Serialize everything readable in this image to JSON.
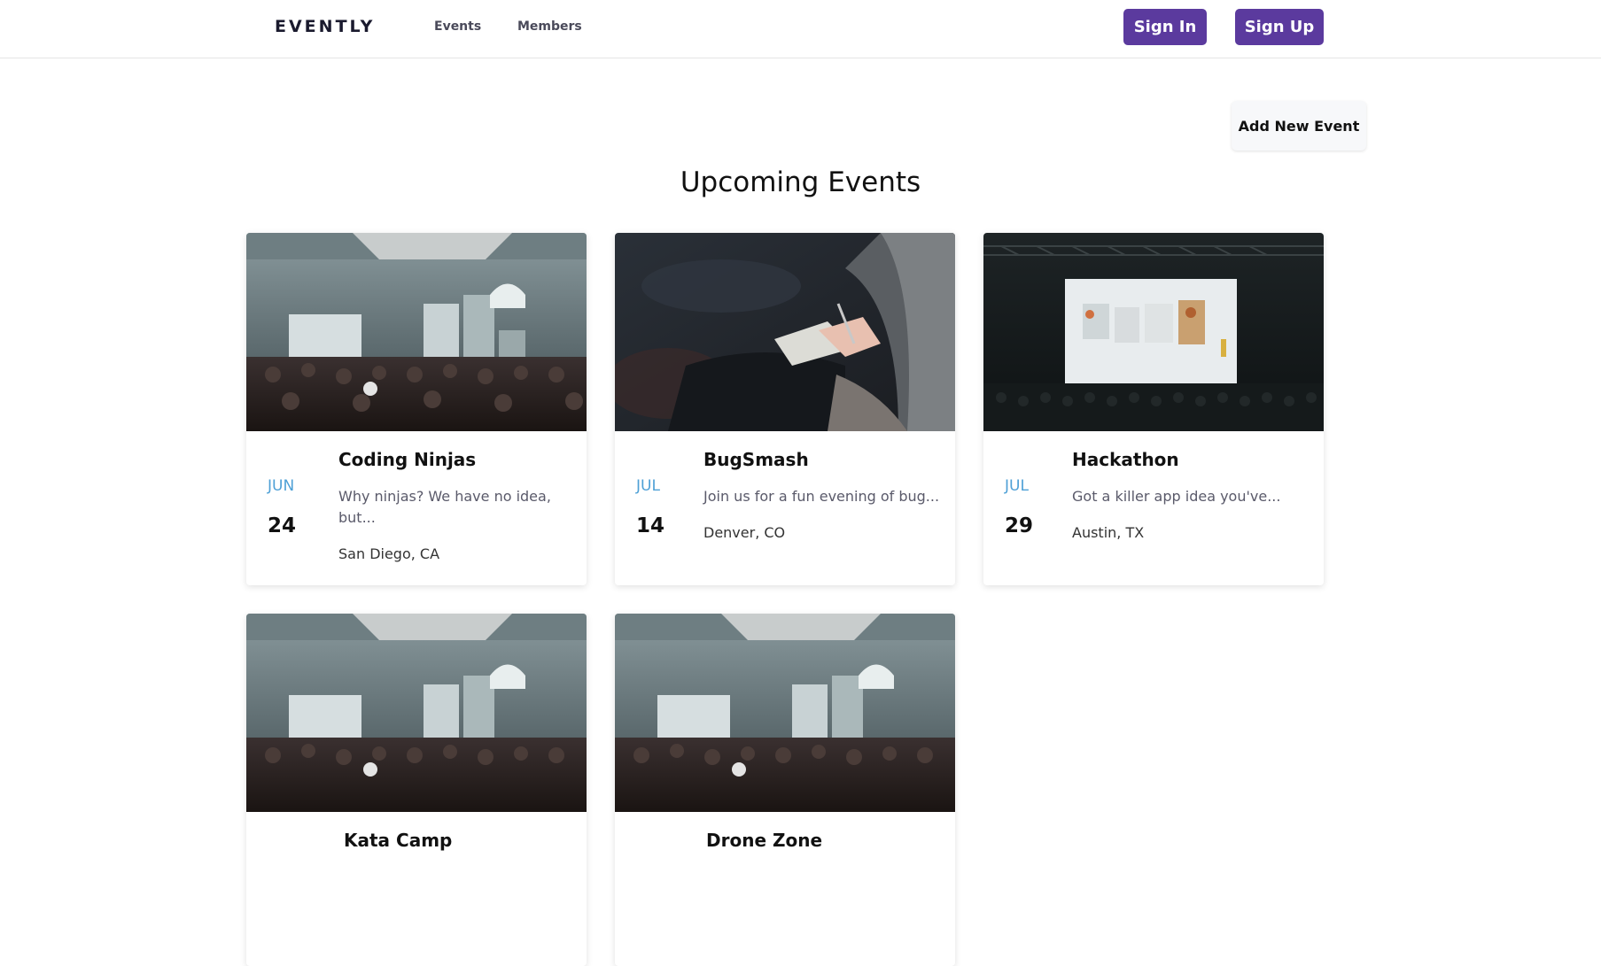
{
  "header": {
    "logo": "EVENTLY",
    "nav": [
      "Events",
      "Members"
    ],
    "signin_label": "Sign In",
    "signup_label": "Sign Up"
  },
  "main": {
    "add_event_label": "Add New Event",
    "title": "Upcoming Events",
    "events": [
      {
        "title": "Coding Ninjas",
        "month": "JUN",
        "day": "24",
        "description": "Why ninjas? We have no idea, but...",
        "location": "San Diego, CA",
        "image": "conference-hall"
      },
      {
        "title": "BugSmash",
        "month": "JUL",
        "day": "14",
        "description": "Join us for a fun evening of bug...",
        "location": "Denver, CO",
        "image": "notebook-writing"
      },
      {
        "title": "Hackathon",
        "month": "JUL",
        "day": "29",
        "description": "Got a killer app idea you've...",
        "location": "Austin, TX",
        "image": "stage-presentation"
      },
      {
        "title": "Kata Camp",
        "image": "conference-hall"
      },
      {
        "title": "Drone Zone",
        "image": "conference-hall"
      }
    ]
  },
  "colors": {
    "accent": "#5b3a9e",
    "month": "#4ea0d6"
  }
}
